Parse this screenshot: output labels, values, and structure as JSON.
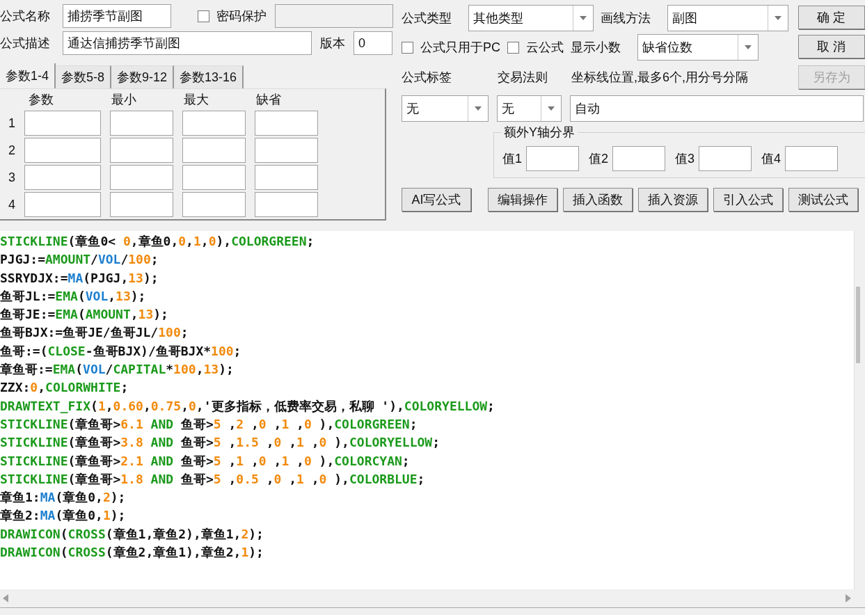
{
  "name_field": {
    "label": "公式名称",
    "value": "捕捞季节副图"
  },
  "password_protect": {
    "label": "密码保护",
    "checked": false
  },
  "password_field": {
    "disabled": true
  },
  "description_field": {
    "label": "公式描述",
    "value": "通达信捕捞季节副图"
  },
  "version_field": {
    "label": "版本",
    "value": "0"
  },
  "param_tabs": [
    {
      "label": "参数1-4",
      "selected": true
    },
    {
      "label": "参数5-8",
      "selected": false
    },
    {
      "label": "参数9-12",
      "selected": false
    },
    {
      "label": "参数13-16",
      "selected": false
    }
  ],
  "param_table": {
    "columns": [
      "参数",
      "最小",
      "最大",
      "缺省"
    ],
    "rows": [
      {
        "number": "1"
      },
      {
        "number": "2"
      },
      {
        "number": "3"
      },
      {
        "number": "4"
      }
    ]
  },
  "formula_type": {
    "label": "公式类型",
    "value": "其他类型"
  },
  "draw_method": {
    "label": "画线方法",
    "value": "副图"
  },
  "pc_only": {
    "label": "公式只用于PC",
    "checked": false
  },
  "cloud_formula": {
    "label": "云公式",
    "checked": false
  },
  "decimals": {
    "label": "显示小数",
    "value": "缺省位数"
  },
  "side_buttons": [
    {
      "label": "确 定",
      "disabled": false
    },
    {
      "label": "取 消",
      "disabled": false
    },
    {
      "label": "另存为",
      "disabled": true
    }
  ],
  "formula_tag": {
    "label": "公式标签",
    "value": "无"
  },
  "trade_rule": {
    "label": "交易法则",
    "value": "无"
  },
  "axis_lines": {
    "label": "坐标线位置,最多6个,用分号分隔",
    "value": "自动"
  },
  "y_axis_bounds": {
    "title": "额外Y轴分界",
    "fields": [
      {
        "label": "值1"
      },
      {
        "label": "值2"
      },
      {
        "label": "值3"
      },
      {
        "label": "值4"
      }
    ]
  },
  "action_buttons": [
    "AI写公式",
    "编辑操作",
    "插入函数",
    "插入资源",
    "引入公式",
    "测试公式"
  ],
  "code_lines": [
    [
      {
        "kind": "function",
        "text": "STICKLINE"
      },
      {
        "kind": "plain",
        "text": "(章鱼0< "
      },
      {
        "kind": "number",
        "text": "0"
      },
      {
        "kind": "plain",
        "text": ",章鱼0,"
      },
      {
        "kind": "number",
        "text": "0"
      },
      {
        "kind": "plain",
        "text": ","
      },
      {
        "kind": "number",
        "text": "1"
      },
      {
        "kind": "plain",
        "text": ","
      },
      {
        "kind": "number",
        "text": "0"
      },
      {
        "kind": "plain",
        "text": "),"
      },
      {
        "kind": "function",
        "text": "COLORGREEN"
      },
      {
        "kind": "plain",
        "text": ";"
      }
    ],
    [
      {
        "kind": "plain",
        "text": "PJGJ:="
      },
      {
        "kind": "function",
        "text": "AMOUNT"
      },
      {
        "kind": "plain",
        "text": "/"
      },
      {
        "kind": "variable",
        "text": "VOL"
      },
      {
        "kind": "plain",
        "text": "/"
      },
      {
        "kind": "number",
        "text": "100"
      },
      {
        "kind": "plain",
        "text": ";"
      }
    ],
    [
      {
        "kind": "plain",
        "text": "SSRYDJX:="
      },
      {
        "kind": "variable",
        "text": "MA"
      },
      {
        "kind": "plain",
        "text": "(PJGJ,"
      },
      {
        "kind": "number",
        "text": "13"
      },
      {
        "kind": "plain",
        "text": ");"
      }
    ],
    [
      {
        "kind": "plain",
        "text": "鱼哥JL:="
      },
      {
        "kind": "function",
        "text": "EMA"
      },
      {
        "kind": "plain",
        "text": "("
      },
      {
        "kind": "variable",
        "text": "VOL"
      },
      {
        "kind": "plain",
        "text": ","
      },
      {
        "kind": "number",
        "text": "13"
      },
      {
        "kind": "plain",
        "text": ");"
      }
    ],
    [
      {
        "kind": "plain",
        "text": "鱼哥JE:="
      },
      {
        "kind": "function",
        "text": "EMA"
      },
      {
        "kind": "plain",
        "text": "("
      },
      {
        "kind": "function",
        "text": "AMOUNT"
      },
      {
        "kind": "plain",
        "text": ","
      },
      {
        "kind": "number",
        "text": "13"
      },
      {
        "kind": "plain",
        "text": ");"
      }
    ],
    [
      {
        "kind": "plain",
        "text": "鱼哥BJX:=鱼哥JE/鱼哥JL/"
      },
      {
        "kind": "number",
        "text": "100"
      },
      {
        "kind": "plain",
        "text": ";"
      }
    ],
    [
      {
        "kind": "plain",
        "text": "鱼哥:=("
      },
      {
        "kind": "function",
        "text": "CLOSE"
      },
      {
        "kind": "plain",
        "text": "-鱼哥BJX)/鱼哥BJX*"
      },
      {
        "kind": "number",
        "text": "100"
      },
      {
        "kind": "plain",
        "text": ";"
      }
    ],
    [
      {
        "kind": "plain",
        "text": "章鱼哥:="
      },
      {
        "kind": "function",
        "text": "EMA"
      },
      {
        "kind": "plain",
        "text": "("
      },
      {
        "kind": "variable",
        "text": "VOL"
      },
      {
        "kind": "plain",
        "text": "/"
      },
      {
        "kind": "function",
        "text": "CAPITAL"
      },
      {
        "kind": "plain",
        "text": "*"
      },
      {
        "kind": "number",
        "text": "100"
      },
      {
        "kind": "plain",
        "text": ","
      },
      {
        "kind": "number",
        "text": "13"
      },
      {
        "kind": "plain",
        "text": ");"
      }
    ],
    [
      {
        "kind": "plain",
        "text": "ZZX:"
      },
      {
        "kind": "number",
        "text": "0"
      },
      {
        "kind": "plain",
        "text": ","
      },
      {
        "kind": "function",
        "text": "COLORWHITE"
      },
      {
        "kind": "plain",
        "text": ";"
      }
    ],
    [
      {
        "kind": "function",
        "text": "DRAWTEXT_FIX"
      },
      {
        "kind": "plain",
        "text": "("
      },
      {
        "kind": "number",
        "text": "1"
      },
      {
        "kind": "plain",
        "text": ","
      },
      {
        "kind": "number",
        "text": "0.60"
      },
      {
        "kind": "plain",
        "text": ","
      },
      {
        "kind": "number",
        "text": "0.75"
      },
      {
        "kind": "plain",
        "text": ","
      },
      {
        "kind": "number",
        "text": "0"
      },
      {
        "kind": "plain",
        "text": ",'更多指标，低费率交易，私聊 '),"
      },
      {
        "kind": "function",
        "text": "COLORYELLOW"
      },
      {
        "kind": "plain",
        "text": ";"
      }
    ],
    [
      {
        "kind": "function",
        "text": "STICKLINE"
      },
      {
        "kind": "plain",
        "text": "(章鱼哥>"
      },
      {
        "kind": "number",
        "text": "6.1"
      },
      {
        "kind": "function",
        "text": " AND"
      },
      {
        "kind": "plain",
        "text": " 鱼哥>"
      },
      {
        "kind": "number",
        "text": "5"
      },
      {
        "kind": "plain",
        "text": " ,"
      },
      {
        "kind": "number",
        "text": "2"
      },
      {
        "kind": "plain",
        "text": " ,"
      },
      {
        "kind": "number",
        "text": "0"
      },
      {
        "kind": "plain",
        "text": " ,"
      },
      {
        "kind": "number",
        "text": "1"
      },
      {
        "kind": "plain",
        "text": " ,"
      },
      {
        "kind": "number",
        "text": "0"
      },
      {
        "kind": "plain",
        "text": " ),"
      },
      {
        "kind": "function",
        "text": "COLORGREEN"
      },
      {
        "kind": "plain",
        "text": ";"
      }
    ],
    [
      {
        "kind": "function",
        "text": "STICKLINE"
      },
      {
        "kind": "plain",
        "text": "(章鱼哥>"
      },
      {
        "kind": "number",
        "text": "3.8"
      },
      {
        "kind": "function",
        "text": " AND"
      },
      {
        "kind": "plain",
        "text": " 鱼哥>"
      },
      {
        "kind": "number",
        "text": "5"
      },
      {
        "kind": "plain",
        "text": " ,"
      },
      {
        "kind": "number",
        "text": "1.5"
      },
      {
        "kind": "plain",
        "text": " ,"
      },
      {
        "kind": "number",
        "text": "0"
      },
      {
        "kind": "plain",
        "text": " ,"
      },
      {
        "kind": "number",
        "text": "1"
      },
      {
        "kind": "plain",
        "text": " ,"
      },
      {
        "kind": "number",
        "text": "0"
      },
      {
        "kind": "plain",
        "text": " ),"
      },
      {
        "kind": "function",
        "text": "COLORYELLOW"
      },
      {
        "kind": "plain",
        "text": ";"
      }
    ],
    [
      {
        "kind": "function",
        "text": "STICKLINE"
      },
      {
        "kind": "plain",
        "text": "(章鱼哥>"
      },
      {
        "kind": "number",
        "text": "2.1"
      },
      {
        "kind": "function",
        "text": " AND"
      },
      {
        "kind": "plain",
        "text": " 鱼哥>"
      },
      {
        "kind": "number",
        "text": "5"
      },
      {
        "kind": "plain",
        "text": " ,"
      },
      {
        "kind": "number",
        "text": "1"
      },
      {
        "kind": "plain",
        "text": " ,"
      },
      {
        "kind": "number",
        "text": "0"
      },
      {
        "kind": "plain",
        "text": " ,"
      },
      {
        "kind": "number",
        "text": "1"
      },
      {
        "kind": "plain",
        "text": " ,"
      },
      {
        "kind": "number",
        "text": "0"
      },
      {
        "kind": "plain",
        "text": " ),"
      },
      {
        "kind": "function",
        "text": "COLORCYAN"
      },
      {
        "kind": "plain",
        "text": ";"
      }
    ],
    [
      {
        "kind": "function",
        "text": "STICKLINE"
      },
      {
        "kind": "plain",
        "text": "(章鱼哥>"
      },
      {
        "kind": "number",
        "text": "1.8"
      },
      {
        "kind": "function",
        "text": " AND"
      },
      {
        "kind": "plain",
        "text": " 鱼哥>"
      },
      {
        "kind": "number",
        "text": "5"
      },
      {
        "kind": "plain",
        "text": " ,"
      },
      {
        "kind": "number",
        "text": "0.5"
      },
      {
        "kind": "plain",
        "text": " ,"
      },
      {
        "kind": "number",
        "text": "0"
      },
      {
        "kind": "plain",
        "text": " ,"
      },
      {
        "kind": "number",
        "text": "1"
      },
      {
        "kind": "plain",
        "text": " ,"
      },
      {
        "kind": "number",
        "text": "0"
      },
      {
        "kind": "plain",
        "text": " ),"
      },
      {
        "kind": "function",
        "text": "COLORBLUE"
      },
      {
        "kind": "plain",
        "text": ";"
      }
    ],
    [
      {
        "kind": "plain",
        "text": "章鱼1:"
      },
      {
        "kind": "variable",
        "text": "MA"
      },
      {
        "kind": "plain",
        "text": "(章鱼0,"
      },
      {
        "kind": "number",
        "text": "2"
      },
      {
        "kind": "plain",
        "text": ");"
      }
    ],
    [
      {
        "kind": "plain",
        "text": "章鱼2:"
      },
      {
        "kind": "variable",
        "text": "MA"
      },
      {
        "kind": "plain",
        "text": "(章鱼0,"
      },
      {
        "kind": "number",
        "text": "1"
      },
      {
        "kind": "plain",
        "text": ");"
      }
    ],
    [
      {
        "kind": "function",
        "text": "DRAWICON"
      },
      {
        "kind": "plain",
        "text": "("
      },
      {
        "kind": "function",
        "text": "CROSS"
      },
      {
        "kind": "plain",
        "text": "(章鱼1,章鱼2),章鱼1,"
      },
      {
        "kind": "number",
        "text": "2"
      },
      {
        "kind": "plain",
        "text": ");"
      }
    ],
    [
      {
        "kind": "function",
        "text": "DRAWICON"
      },
      {
        "kind": "plain",
        "text": "("
      },
      {
        "kind": "function",
        "text": "CROSS"
      },
      {
        "kind": "plain",
        "text": "(章鱼2,章鱼1),章鱼2,"
      },
      {
        "kind": "number",
        "text": "1"
      },
      {
        "kind": "plain",
        "text": ");"
      }
    ]
  ]
}
